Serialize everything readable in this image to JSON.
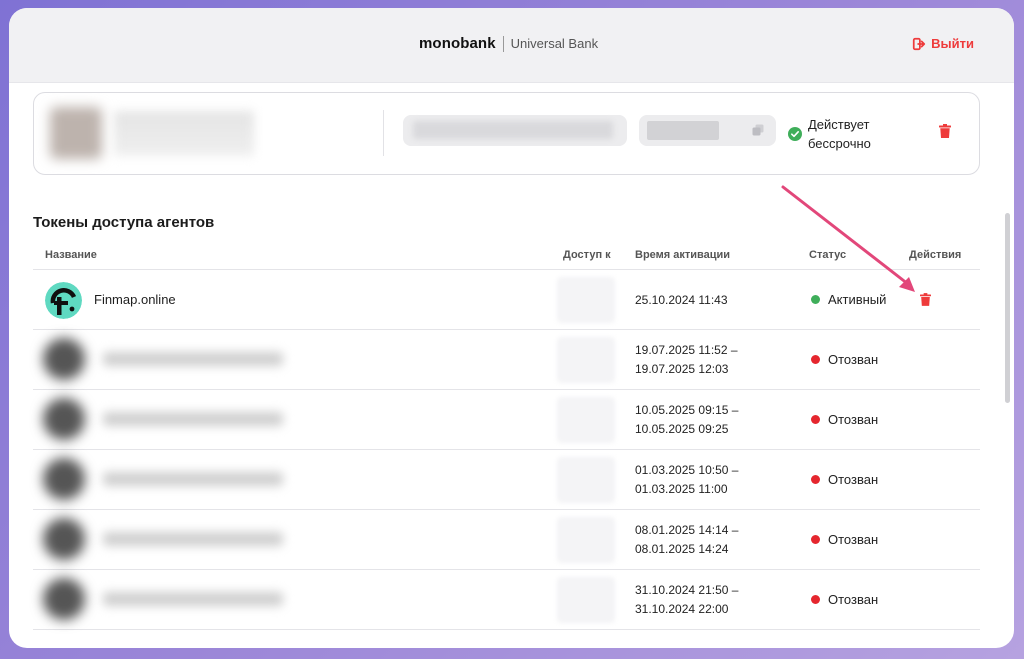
{
  "header": {
    "brand": "monobank",
    "brand_sub": "Universal Bank",
    "logout_label": "Выйти"
  },
  "account": {
    "status_line1": "Действует",
    "status_line2": "бессрочно"
  },
  "section_title": "Токены доступа агентов",
  "table": {
    "columns": {
      "name": "Название",
      "access": "Доступ к",
      "time": "Время активации",
      "status": "Статус",
      "actions": "Действия"
    },
    "first_row": {
      "name": "Finmap.online",
      "time": "25.10.2024 11:43",
      "status": "Активный"
    },
    "revoked_rows": [
      {
        "time_start": "19.07.2025 11:52 –",
        "time_end": "19.07.2025 12:03",
        "status": "Отозван"
      },
      {
        "time_start": "10.05.2025 09:15 –",
        "time_end": "10.05.2025 09:25",
        "status": "Отозван"
      },
      {
        "time_start": "01.03.2025 10:50 –",
        "time_end": "01.03.2025 11:00",
        "status": "Отозван"
      },
      {
        "time_start": "08.01.2025 14:14 –",
        "time_end": "08.01.2025 14:24",
        "status": "Отозван"
      },
      {
        "time_start": "31.10.2024 21:50 –",
        "time_end": "31.10.2024 22:00",
        "status": "Отозван"
      }
    ]
  },
  "colors": {
    "accent_red": "#ee3b3b",
    "active_green": "#3fae5a",
    "revoked_red": "#e5262e",
    "arrow_pink": "#e2477a"
  },
  "icons": {
    "logout": "logout-icon",
    "trash": "trash-icon",
    "copy": "copy-icon",
    "check": "check-circle-icon"
  }
}
